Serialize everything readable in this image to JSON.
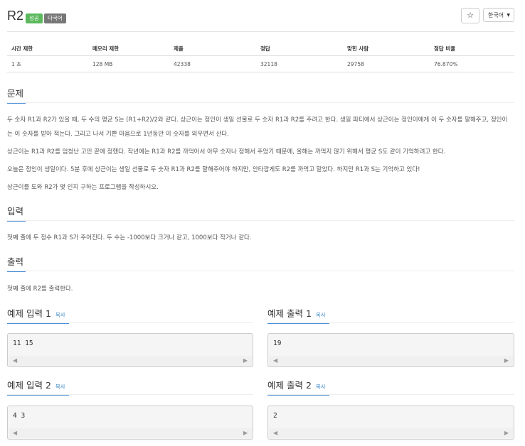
{
  "problem": {
    "title": "R2",
    "badges": {
      "success": "성공",
      "multi": "다국어"
    }
  },
  "header": {
    "star": "☆",
    "language": "한국어",
    "caret": "▼"
  },
  "info_table": {
    "headers": [
      "시간 제한",
      "메모리 제한",
      "제출",
      "정답",
      "맞힌 사람",
      "정답 비율"
    ],
    "values": [
      "1 초",
      "128 MB",
      "42338",
      "32118",
      "29758",
      "76.870%"
    ]
  },
  "sections": {
    "problem": {
      "title": "문제",
      "paragraphs": [
        "두 숫자 R1과 R2가 있을 때, 두 수의 평균 S는 (R1+R2)/2와 같다. 상근이는 정인이 생일 선물로 두 숫자 R1과 R2를 주려고 한다. 생일 파티에서 상근이는 정인이에게 이 두 숫자를 말해주고, 정인이는 이 숫자를 받아 적는다. 그리고 나서 기쁜 마음으로 1년동안 이 숫자를 외우면서 산다.",
        "상근이는 R1과 R2를 엄청난 고민 끝에 정했다. 작년에는 R1과 R2를 까먹어서 아무 숫자나 정해서 주었기 때문에, 올해는 까먹지 않기 위해서 평균 S도 같이 기억하려고 한다.",
        "오늘은 정인이 생일이다. 5분 후에 상근이는 생일 선물로 두 숫자 R1과 R2를 말해주어야 하지만, 안타깝게도 R2를 까먹고 말았다. 하지만 R1과 S는 기억하고 있다!",
        "상근이를 도와 R2가 몇 인지 구하는 프로그램을 작성하시오."
      ]
    },
    "input": {
      "title": "입력",
      "text": "첫째 줄에 두 정수 R1과 S가 주어진다. 두 수는 -1000보다 크거나 같고, 1000보다 작거나 같다."
    },
    "output": {
      "title": "출력",
      "text": "첫째 줄에 R2를 출력한다."
    }
  },
  "examples": [
    {
      "input_title": "예제 입력 1",
      "output_title": "예제 출력 1",
      "input": "11 15",
      "output": "19"
    },
    {
      "input_title": "예제 입력 2",
      "output_title": "예제 출력 2",
      "input": "4 3",
      "output": "2"
    }
  ],
  "copy_label": "복사",
  "scroll": {
    "left": "◀",
    "right": "▶"
  }
}
